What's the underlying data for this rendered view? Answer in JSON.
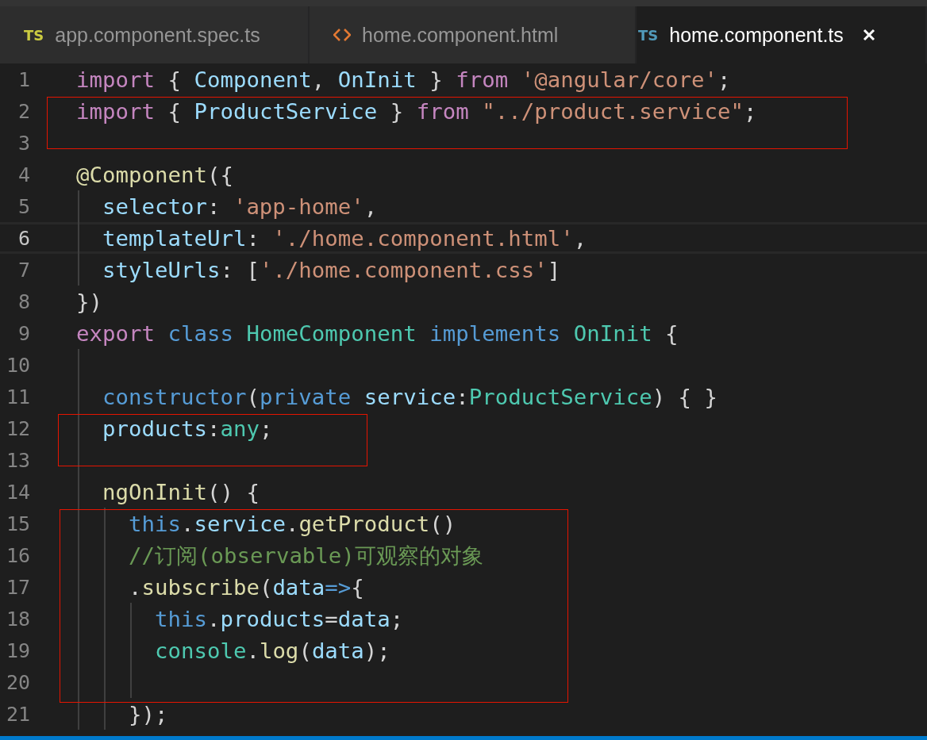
{
  "tabs": [
    {
      "kind": "ts",
      "badge": "TS",
      "label": "app.component.spec.ts",
      "selected": false
    },
    {
      "kind": "html",
      "label": "home.component.html",
      "selected": false
    },
    {
      "kind": "ts",
      "badge": "TS",
      "label": "home.component.ts",
      "selected": true,
      "closable": true
    }
  ],
  "editor": {
    "lines": [
      {
        "number": "1",
        "tokens": [
          {
            "kind": "control",
            "text": "import"
          },
          {
            "kind": "punct",
            "text": " { "
          },
          {
            "kind": "variable",
            "text": "Component"
          },
          {
            "kind": "punct",
            "text": ", "
          },
          {
            "kind": "variable",
            "text": "OnInit"
          },
          {
            "kind": "punct",
            "text": " } "
          },
          {
            "kind": "control",
            "text": "from"
          },
          {
            "kind": "string",
            "text": " '@angular/core'"
          },
          {
            "kind": "punct",
            "text": ";"
          }
        ]
      },
      {
        "number": "2",
        "boxed": true,
        "tokens": [
          {
            "kind": "control",
            "text": "import"
          },
          {
            "kind": "punct",
            "text": " { "
          },
          {
            "kind": "variable",
            "text": "ProductService"
          },
          {
            "kind": "punct",
            "text": " } "
          },
          {
            "kind": "control",
            "text": "from"
          },
          {
            "kind": "string",
            "text": " \"../product.service\""
          },
          {
            "kind": "punct",
            "text": ";"
          }
        ]
      },
      {
        "number": "3",
        "boxed": true
      },
      {
        "number": "4",
        "tokens": [
          {
            "kind": "function",
            "text": "@Component"
          },
          {
            "kind": "punct",
            "text": "({"
          }
        ]
      },
      {
        "number": "5",
        "tokens": [
          {
            "kind": "variable",
            "text": "  selector"
          },
          {
            "kind": "punct",
            "text": ": "
          },
          {
            "kind": "string",
            "text": "'app-home'"
          },
          {
            "kind": "punct",
            "text": ","
          }
        ]
      },
      {
        "number": "6",
        "current": true,
        "tokens": [
          {
            "kind": "variable",
            "text": "  templateUrl"
          },
          {
            "kind": "punct",
            "text": ": "
          },
          {
            "kind": "string",
            "text": "'./home.component.html'"
          },
          {
            "kind": "punct",
            "text": ","
          }
        ]
      },
      {
        "number": "7",
        "tokens": [
          {
            "kind": "variable",
            "text": "  styleUrls"
          },
          {
            "kind": "punct",
            "text": ": ["
          },
          {
            "kind": "string",
            "text": "'./home.component.css'"
          },
          {
            "kind": "punct",
            "text": "]"
          }
        ]
      },
      {
        "number": "8",
        "tokens": [
          {
            "kind": "punct",
            "text": "})"
          }
        ]
      },
      {
        "number": "9",
        "tokens": [
          {
            "kind": "control",
            "text": "export"
          },
          {
            "kind": "keyword",
            "text": " class"
          },
          {
            "kind": "type",
            "text": " HomeComponent"
          },
          {
            "kind": "keyword",
            "text": " implements"
          },
          {
            "kind": "type",
            "text": " OnInit"
          },
          {
            "kind": "punct",
            "text": " {"
          }
        ]
      },
      {
        "number": "10"
      },
      {
        "number": "11",
        "tokens": [
          {
            "kind": "keyword",
            "text": "  constructor"
          },
          {
            "kind": "punct",
            "text": "("
          },
          {
            "kind": "keyword",
            "text": "private"
          },
          {
            "kind": "variable",
            "text": " service"
          },
          {
            "kind": "punct",
            "text": ":"
          },
          {
            "kind": "type",
            "text": "ProductService"
          },
          {
            "kind": "punct",
            "text": ") { }"
          }
        ]
      },
      {
        "number": "12",
        "boxed": true,
        "tokens": [
          {
            "kind": "variable",
            "text": "  products"
          },
          {
            "kind": "punct",
            "text": ":"
          },
          {
            "kind": "type",
            "text": "any"
          },
          {
            "kind": "punct",
            "text": ";"
          }
        ]
      },
      {
        "number": "13",
        "boxed": true
      },
      {
        "number": "14",
        "tokens": [
          {
            "kind": "function",
            "text": "  ngOnInit"
          },
          {
            "kind": "punct",
            "text": "() {"
          }
        ]
      },
      {
        "number": "15",
        "boxed": true,
        "tokens": [
          {
            "kind": "keyword",
            "text": "    this"
          },
          {
            "kind": "punct",
            "text": "."
          },
          {
            "kind": "variable",
            "text": "service"
          },
          {
            "kind": "punct",
            "text": "."
          },
          {
            "kind": "function",
            "text": "getProduct"
          },
          {
            "kind": "punct",
            "text": "()"
          }
        ]
      },
      {
        "number": "16",
        "boxed": true,
        "tokens": [
          {
            "kind": "comment",
            "text": "    //订阅(observable)可观察的对象"
          }
        ]
      },
      {
        "number": "17",
        "boxed": true,
        "tokens": [
          {
            "kind": "punct",
            "text": "    ."
          },
          {
            "kind": "function",
            "text": "subscribe"
          },
          {
            "kind": "punct",
            "text": "("
          },
          {
            "kind": "variable",
            "text": "data"
          },
          {
            "kind": "keyword",
            "text": "=>"
          },
          {
            "kind": "punct",
            "text": "{"
          }
        ]
      },
      {
        "number": "18",
        "boxed": true,
        "tokens": [
          {
            "kind": "keyword",
            "text": "      this"
          },
          {
            "kind": "punct",
            "text": "."
          },
          {
            "kind": "variable",
            "text": "products"
          },
          {
            "kind": "punct",
            "text": "="
          },
          {
            "kind": "variable",
            "text": "data"
          },
          {
            "kind": "punct",
            "text": ";"
          }
        ]
      },
      {
        "number": "19",
        "boxed": true,
        "tokens": [
          {
            "kind": "type",
            "text": "      console"
          },
          {
            "kind": "punct",
            "text": "."
          },
          {
            "kind": "function",
            "text": "log"
          },
          {
            "kind": "punct",
            "text": "("
          },
          {
            "kind": "variable",
            "text": "data"
          },
          {
            "kind": "punct",
            "text": ");"
          }
        ]
      },
      {
        "number": "20",
        "boxed": true
      },
      {
        "number": "21",
        "tokens": [
          {
            "kind": "punct",
            "text": "    });"
          }
        ]
      }
    ]
  }
}
